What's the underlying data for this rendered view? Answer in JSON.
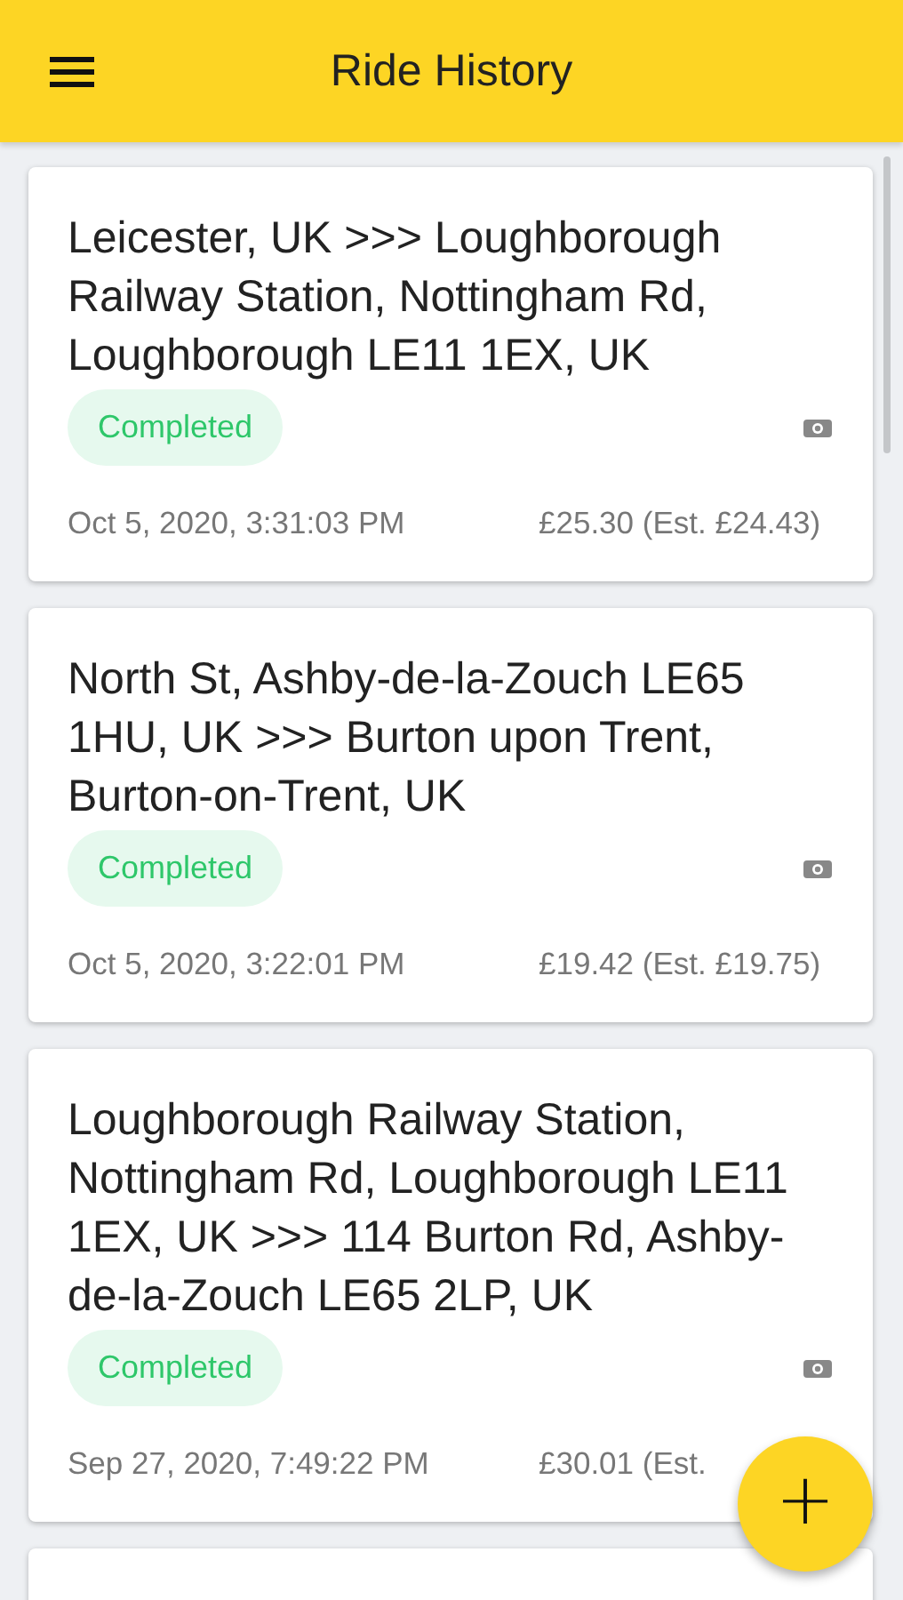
{
  "app_bar": {
    "title": "Ride History"
  },
  "rides": [
    {
      "route": "Leicester, UK >>> Loughborough Railway Station, Nottingham Rd, Loughborough LE11 1EX, UK",
      "status": "Completed",
      "date": "Oct 5, 2020, 3:31:03 PM",
      "fare": "£25.30 (Est. £24.43)"
    },
    {
      "route": "North St, Ashby-de-la-Zouch LE65 1HU, UK >>> Burton upon Trent, Burton-on-Trent, UK",
      "status": "Completed",
      "date": "Oct 5, 2020, 3:22:01 PM",
      "fare": "£19.42 (Est. £19.75)"
    },
    {
      "route": "Loughborough Railway Station, Nottingham Rd, Loughborough LE11 1EX, UK >>> 114 Burton Rd, Ashby-de-la-Zouch LE65 2LP, UK",
      "status": "Completed",
      "date": "Sep 27, 2020, 7:49:22 PM",
      "fare": "£30.01 (Est."
    }
  ],
  "fab": {
    "label": "+"
  }
}
